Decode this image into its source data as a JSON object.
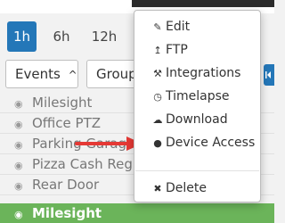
{
  "time_range": {
    "options": [
      {
        "label": "1h",
        "active": true
      },
      {
        "label": "6h",
        "active": false
      },
      {
        "label": "12h",
        "active": false
      }
    ]
  },
  "filters": {
    "events_label": "Events",
    "events_caret": "^",
    "group_label": "Group"
  },
  "cameras": [
    {
      "name": "Milesight",
      "active": false
    },
    {
      "name": "Office PTZ",
      "active": false
    },
    {
      "name": "Parking Garage",
      "active": false
    },
    {
      "name": "Pizza Cash Register",
      "active": false
    },
    {
      "name": "Rear Door",
      "active": false
    },
    {
      "name": "Milesight",
      "active": true
    }
  ],
  "context_menu": {
    "items": [
      {
        "label": "Edit",
        "icon": "pencil-icon"
      },
      {
        "label": "FTP",
        "icon": "upload-icon"
      },
      {
        "label": "Integrations",
        "icon": "wrench-icon"
      },
      {
        "label": "Timelapse",
        "icon": "timelapse-icon"
      },
      {
        "label": "Download",
        "icon": "cloud-download-icon"
      },
      {
        "label": "Device Access",
        "icon": "globe-icon"
      }
    ],
    "delete": {
      "label": "Delete",
      "icon": "close-icon"
    }
  },
  "colors": {
    "accent_blue": "#2477b8",
    "active_green": "#6bb45a",
    "annotation_red": "#e53935"
  }
}
